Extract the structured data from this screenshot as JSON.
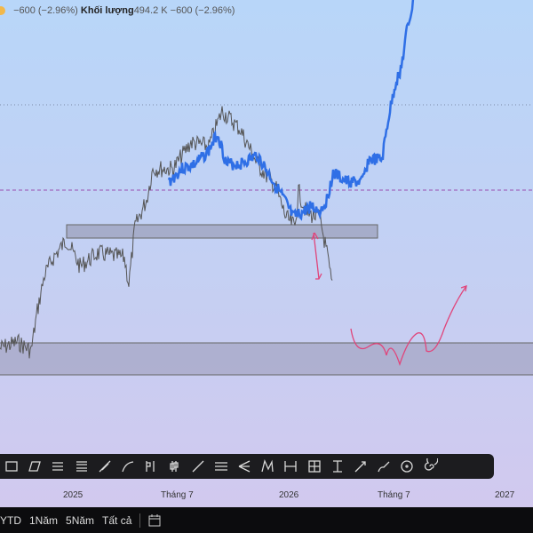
{
  "legend": {
    "change1": "−600 (−2.96%)",
    "volume_label": "Khối lượng",
    "volume_value": "494.2 K",
    "change2": "−600 (−2.96%)"
  },
  "colors": {
    "price_line": "#2f6fe6",
    "history_line": "#555555",
    "annotation": "#e0457b",
    "zone_fill": "#8f8fa8"
  },
  "toolbar": {
    "tools": [
      "rectangle-icon",
      "parallel-channel-icon",
      "fib-retracement-icon",
      "fib-extension-icon",
      "trend-angle-icon",
      "path-icon",
      "long-short-icon",
      "candles-icon",
      "trend-line-icon",
      "horizontal-lines-icon",
      "pitchfork-icon",
      "xabcd-pattern-icon",
      "date-range-icon",
      "date-price-range-icon",
      "price-range-icon",
      "arrow-icon",
      "brush-icon",
      "circle-icon",
      "spiral-icon"
    ]
  },
  "time_axis": [
    "2025",
    "Tháng 7",
    "2026",
    "Tháng 7",
    "2027"
  ],
  "ranges": {
    "items": [
      "YTD",
      "1Năm",
      "5Năm",
      "Tất cả"
    ],
    "calendar": "calendar-icon"
  }
}
